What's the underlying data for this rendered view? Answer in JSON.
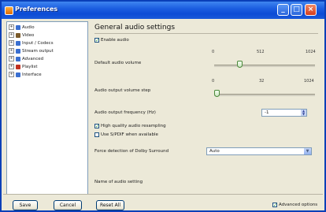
{
  "window": {
    "title": "Preferences",
    "minimize_glyph": "_",
    "maximize_glyph": "□",
    "close_glyph": "×"
  },
  "tree": {
    "items": [
      {
        "label": "Audio",
        "icon": "speaker-icon",
        "color": "#3a6fd0",
        "expanded": true
      },
      {
        "label": "Video",
        "icon": "film-icon",
        "color": "#7a5a2a",
        "expanded": true
      },
      {
        "label": "Input / Codecs",
        "icon": "input-icon",
        "color": "#3a6fd0",
        "expanded": true
      },
      {
        "label": "Stream output",
        "icon": "stream-icon",
        "color": "#3a6fd0",
        "expanded": true
      },
      {
        "label": "Advanced",
        "icon": "advanced-icon",
        "color": "#3a6fd0",
        "expanded": true
      },
      {
        "label": "Playlist",
        "icon": "playlist-icon",
        "color": "#c03020",
        "expanded": true
      },
      {
        "label": "Interface",
        "icon": "interface-icon",
        "color": "#3a6fd0",
        "expanded": true
      }
    ]
  },
  "panel": {
    "heading": "General audio settings",
    "enable_audio": {
      "label": "Enable audio",
      "checked": true
    },
    "default_volume": {
      "label": "Default audio volume",
      "ticks": [
        "0",
        "512",
        "1024"
      ],
      "value_fraction": 0.25
    },
    "volume_step": {
      "label": "Audio output volume step",
      "ticks": [
        "0",
        "32",
        "1024"
      ],
      "value_fraction": 0.02
    },
    "sample_rate": {
      "label": "Audio output frequency (Hz)",
      "value": "-1"
    },
    "hq_resampling": {
      "label": "High quality audio resampling",
      "checked": true
    },
    "spdif": {
      "label": "Use S/PDIF when available",
      "checked": false
    },
    "dolby": {
      "label": "Force detection of Dolby Surround",
      "value": "Auto"
    },
    "footer_text": "Name of audio setting"
  },
  "buttons": {
    "save": "Save",
    "cancel": "Cancel",
    "reset": "Reset All"
  },
  "advanced_options": {
    "label": "Advanced options",
    "checked": true
  }
}
